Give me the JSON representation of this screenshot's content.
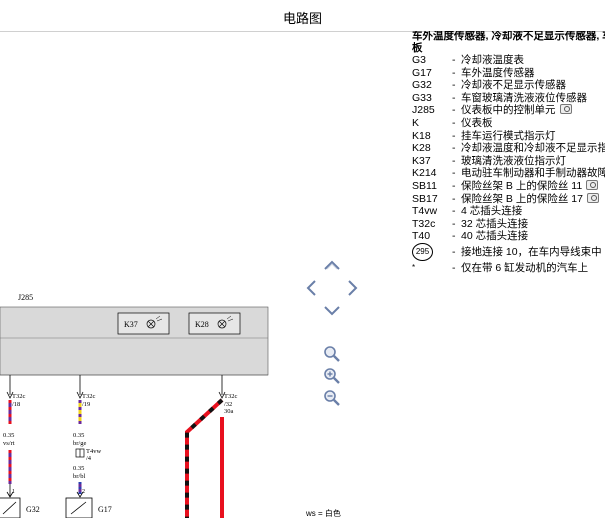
{
  "window": {
    "title": "电路图"
  },
  "legend": {
    "heading_line1": "车外温度传感器, 冷却液不足显示传感器, 车",
    "heading_line2": "板",
    "items": [
      {
        "code": "G3",
        "dash": "-",
        "desc": "冷却液温度表",
        "camera": false
      },
      {
        "code": "G17",
        "dash": "-",
        "desc": "车外温度传感器",
        "camera": false
      },
      {
        "code": "G32",
        "dash": "-",
        "desc": "冷却液不足显示传感器",
        "camera": false
      },
      {
        "code": "G33",
        "dash": "-",
        "desc": "车窗玻璃清洗液液位传感器",
        "camera": false
      },
      {
        "code": "J285",
        "dash": "-",
        "desc": "仪表板中的控制单元",
        "camera": true
      },
      {
        "code": "K",
        "dash": "-",
        "desc": "仪表板",
        "camera": false
      },
      {
        "code": "K18",
        "dash": "-",
        "desc": "挂车运行模式指示灯",
        "camera": false
      },
      {
        "code": "K28",
        "dash": "-",
        "desc": "冷却液温度和冷却液不足显示指",
        "camera": false
      },
      {
        "code": "K37",
        "dash": "-",
        "desc": "玻璃清洗液液位指示灯",
        "camera": false
      },
      {
        "code": "K214",
        "dash": "-",
        "desc": "电动驻车制动器和手制动器故障",
        "camera": false
      },
      {
        "code": "SB11",
        "dash": "-",
        "desc": "保险丝架 B 上的保险丝 11",
        "camera": true
      },
      {
        "code": "SB17",
        "dash": "-",
        "desc": "保险丝架 B 上的保险丝 17",
        "camera": true
      },
      {
        "code": "T4vw",
        "dash": "-",
        "desc": "4 芯插头连接",
        "camera": false
      },
      {
        "code": "T32c",
        "dash": "-",
        "desc": "32 芯插头连接",
        "camera": false
      },
      {
        "code": "T40",
        "dash": "-",
        "desc": "40 芯插头连接",
        "camera": false
      }
    ],
    "ground_symbol": "295",
    "ground_desc": "接地连接 10，在车内导线束中",
    "star_symbol": "*",
    "star_desc": "仅在带 6 缸发动机的汽车上"
  },
  "diagram": {
    "module_label": "J285",
    "k37_label": "K37",
    "k28_label": "K28",
    "conn1": {
      "name": "T32c",
      "pin": "/18"
    },
    "conn2": {
      "name": "T32c",
      "pin": "/19"
    },
    "conn3": {
      "name": "T32c",
      "pin": "/32",
      "pin2": "30a"
    },
    "wire1": {
      "size": "0.35",
      "color": "vs/rt"
    },
    "wire2": {
      "size": "0.35",
      "color": "br/ge"
    },
    "t4vw": {
      "name": "T4vw",
      "pin": "/4"
    },
    "wire2b": {
      "size": "0.35",
      "color": "br/bl"
    },
    "pin1": "1",
    "pin2": "2",
    "g32_label": "G32",
    "g17_label": "G17",
    "color_note": "ws = 白色"
  },
  "colors": {
    "module_fill": "#d9d9d9",
    "wire_red": "#e8101e",
    "wire_purple": "#6a2a9a",
    "wire_yellow": "#f2d21a",
    "wire_black": "#111111",
    "nav_icon": "#6a7fa8"
  }
}
